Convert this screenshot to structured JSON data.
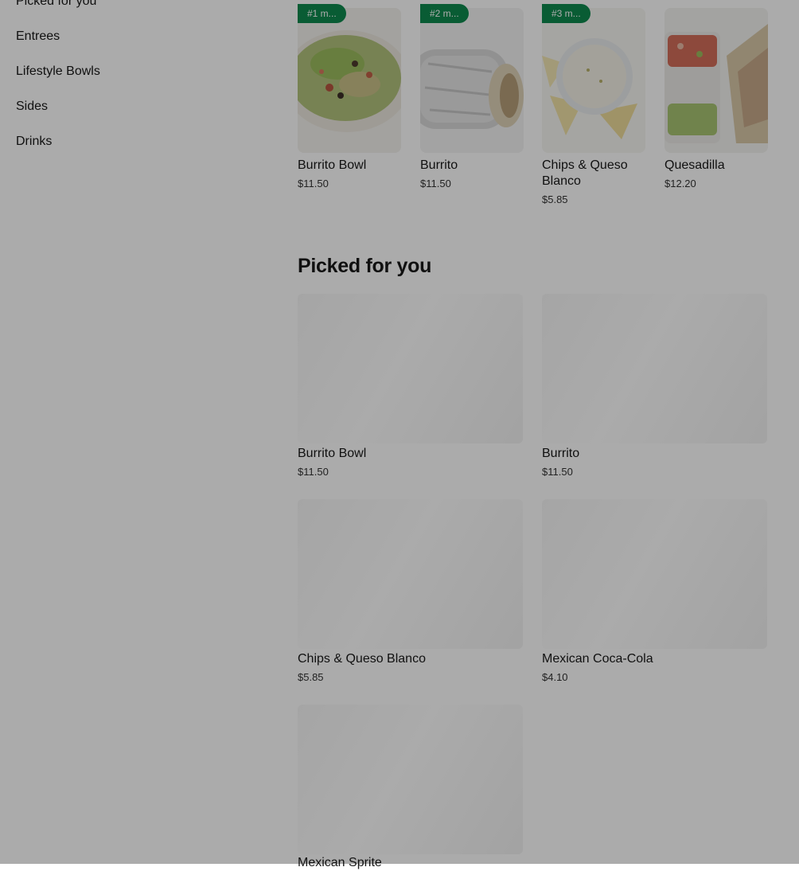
{
  "sidebar": {
    "items": [
      {
        "label": "Picked for you"
      },
      {
        "label": "Entrees"
      },
      {
        "label": "Lifestyle Bowls"
      },
      {
        "label": "Sides"
      },
      {
        "label": "Drinks"
      }
    ]
  },
  "most_liked": {
    "items": [
      {
        "badge": "#1 m...",
        "name": "Burrito Bowl",
        "price": "$11.50"
      },
      {
        "badge": "#2 m...",
        "name": "Burrito",
        "price": "$11.50"
      },
      {
        "badge": "#3 m...",
        "name": "Chips & Queso Blanco",
        "price": "$5.85"
      },
      {
        "name": "Quesadilla",
        "price": "$12.20"
      }
    ]
  },
  "picked": {
    "title": "Picked for you",
    "items": [
      {
        "name": "Burrito Bowl",
        "price": "$11.50"
      },
      {
        "name": "Burrito",
        "price": "$11.50"
      },
      {
        "name": "Chips & Queso Blanco",
        "price": "$5.85"
      },
      {
        "name": "Mexican Coca-Cola",
        "price": "$4.10"
      },
      {
        "name": "Mexican Sprite"
      }
    ]
  },
  "colors": {
    "badge": "#0e8a4e",
    "overlay": "rgba(0,0,0,0.33)"
  }
}
